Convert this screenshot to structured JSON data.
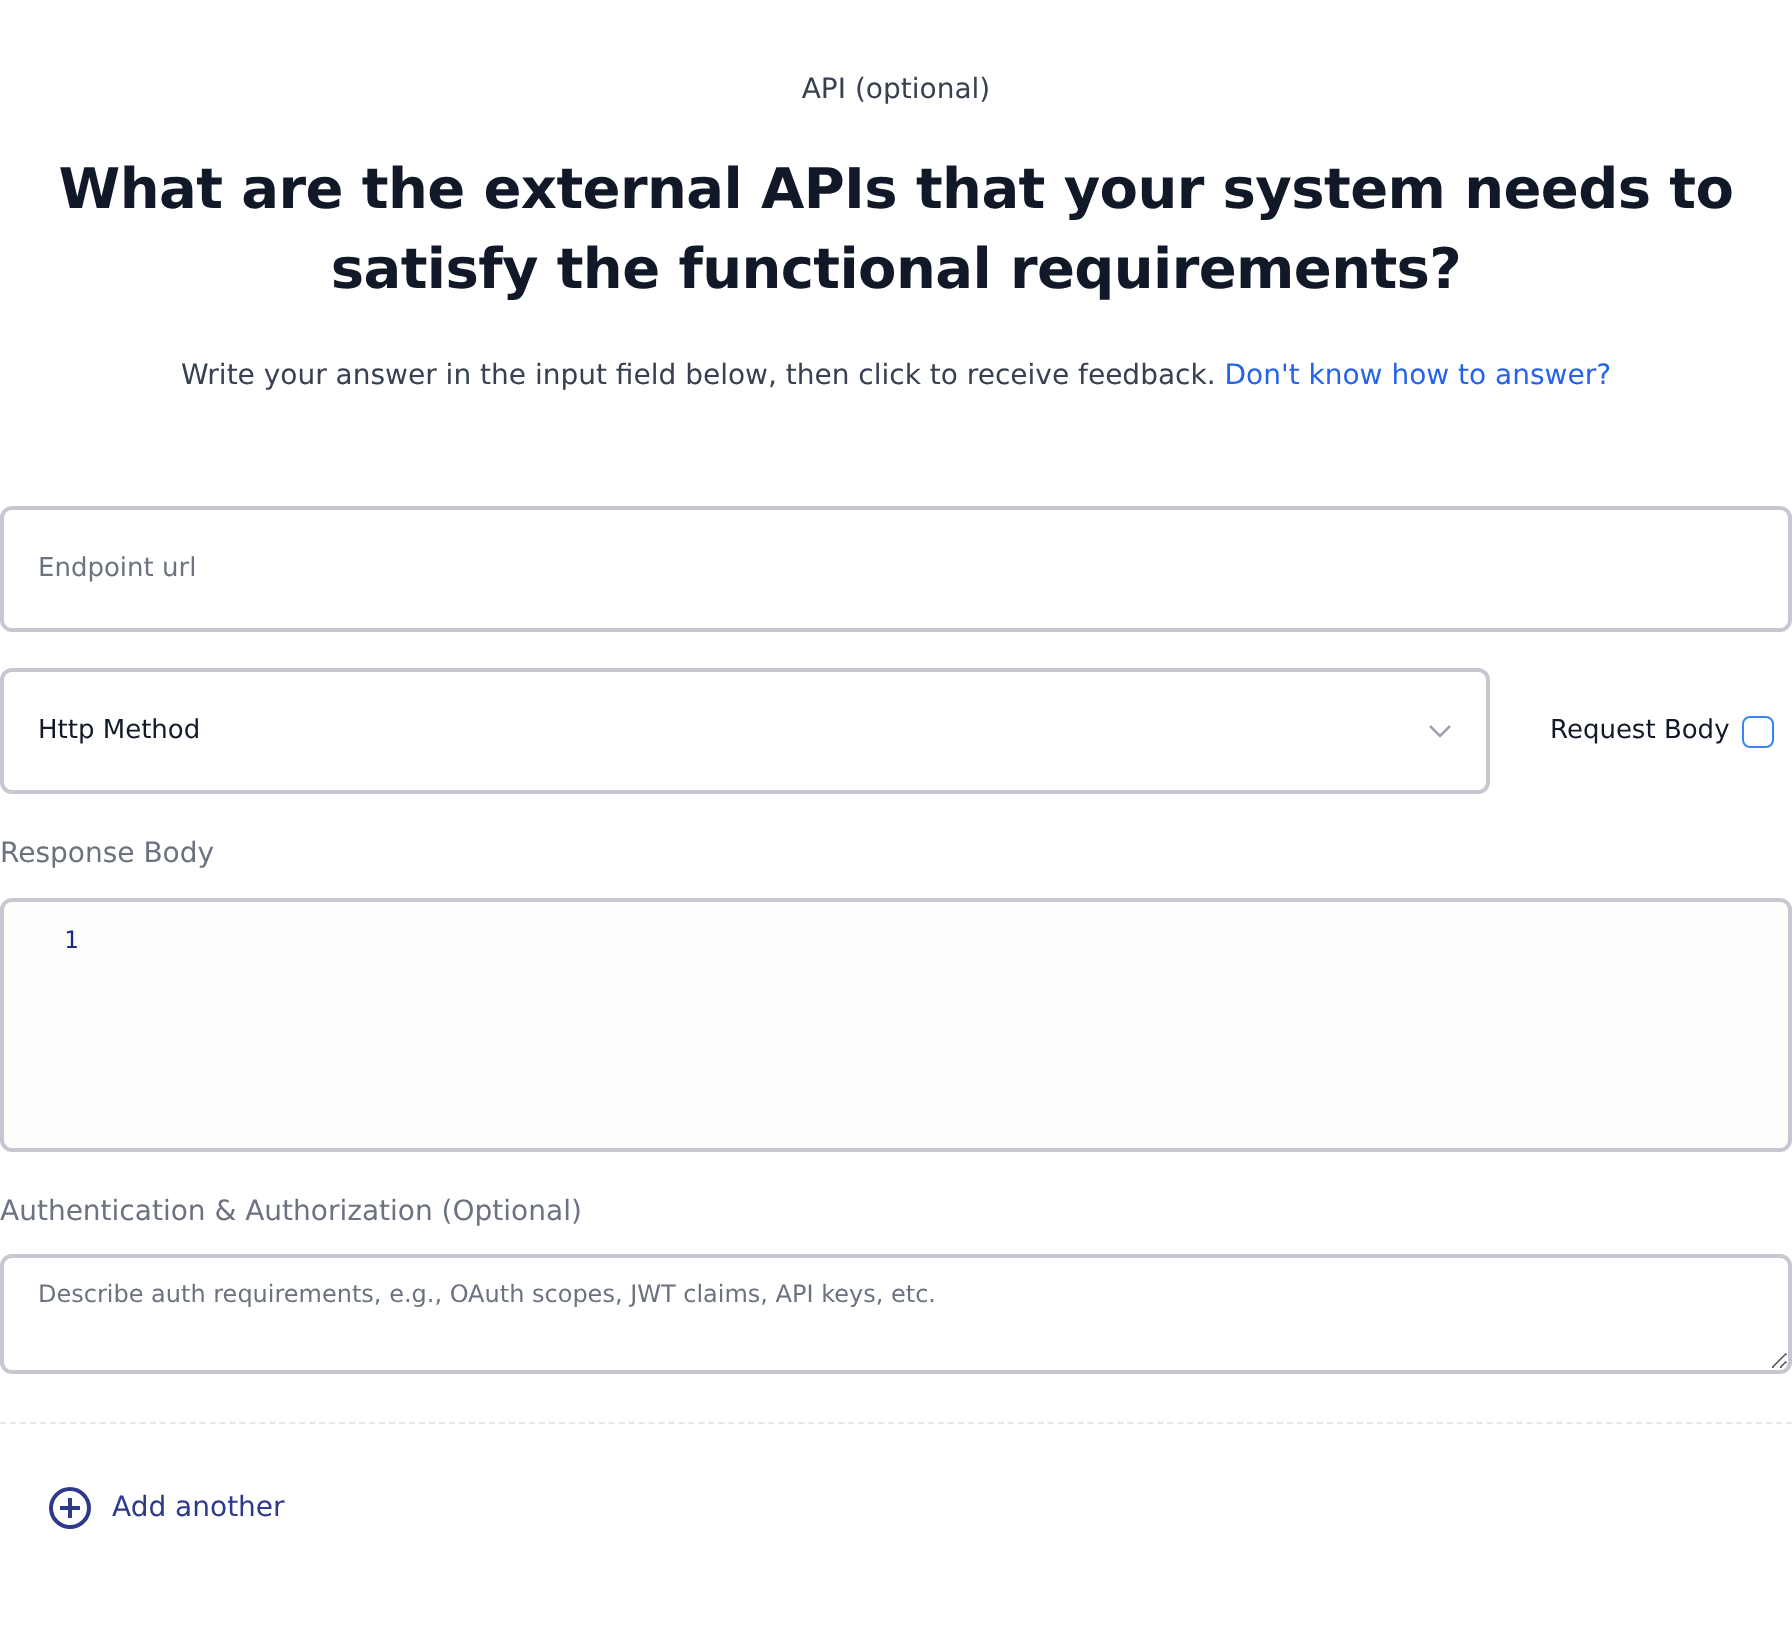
{
  "step_label": "API (optional)",
  "question": "What are the external APIs that your system needs to satisfy the functional requirements?",
  "instructions": "Write your answer in the input field below, then click to receive feedback.",
  "help_link": "Don't know how to answer?",
  "endpoint": {
    "placeholder": "Endpoint url"
  },
  "http_method": {
    "value": "Http Method"
  },
  "request_body": {
    "label": "Request Body",
    "checked": false
  },
  "response_body": {
    "label": "Response Body",
    "line_numbers": [
      "1"
    ]
  },
  "auth": {
    "label": "Authentication & Authorization (Optional)",
    "placeholder": "Describe auth requirements, e.g., OAuth scopes, JWT claims, API keys, etc."
  },
  "add_button": "Add another"
}
